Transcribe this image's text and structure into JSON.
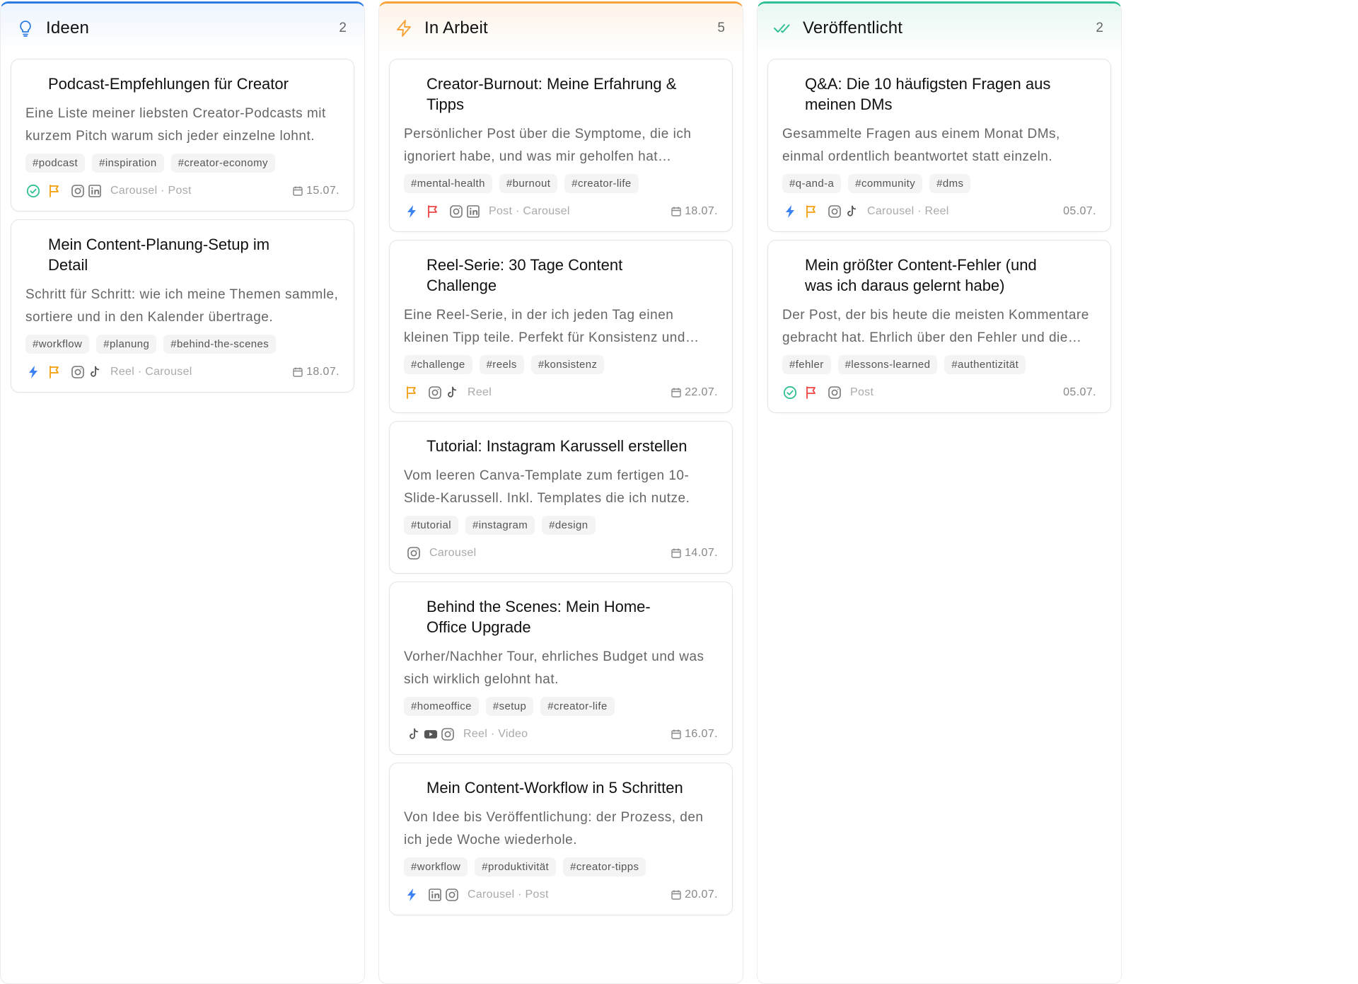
{
  "colors": {
    "ideen_accent": "#2b7de1",
    "arbeit_accent": "#f7a33a",
    "publ_accent": "#2fbf94",
    "check": "#2fbf94",
    "bolt": "#3b82f6",
    "flag_orange": "#f59e0b",
    "flag_red": "#ef4444"
  },
  "columns": [
    {
      "id": "ideen",
      "title": "Ideen",
      "count": "2",
      "icon": "lightbulb-icon",
      "cards": [
        {
          "title": "Podcast-Empfehlungen für Creator",
          "desc": "Eine Liste meiner liebsten Creator-Podcasts mit kurzem Pitch warum sich jeder einzelne lohnt.",
          "tags": [
            "#podcast",
            "#inspiration",
            "#creator-economy"
          ],
          "status": "check",
          "flag": "orange",
          "platforms": [
            "instagram",
            "linkedin"
          ],
          "formats": "Carousel · Post",
          "date": "15.07.",
          "show_cal": true
        },
        {
          "title": "Mein Content-Planung-Setup im Detail",
          "desc": "Schritt für Schritt: wie ich meine Themen sammle, sortiere und in den Kalender übertrage.",
          "tags": [
            "#workflow",
            "#planung",
            "#behind-the-scenes"
          ],
          "status": "bolt",
          "flag": "orange",
          "platforms": [
            "instagram",
            "tiktok"
          ],
          "formats": "Reel · Carousel",
          "date": "18.07.",
          "show_cal": true
        }
      ]
    },
    {
      "id": "arbeit",
      "title": "In Arbeit",
      "count": "5",
      "icon": "bolt-icon",
      "cards": [
        {
          "title": "Creator-Burnout: Meine Erfahrung & Tipps",
          "desc": "Persönlicher Post über die Symptome, die ich ignoriert habe, und was mir geholfen hat zurückzufinden.",
          "tags": [
            "#mental-health",
            "#burnout",
            "#creator-life"
          ],
          "status": "bolt",
          "flag": "red",
          "platforms": [
            "instagram",
            "linkedin"
          ],
          "formats": "Post · Carousel",
          "date": "18.07.",
          "show_cal": true
        },
        {
          "title": "Reel-Serie: 30 Tage Content Challenge",
          "desc": "Eine Reel-Serie, in der ich jeden Tag einen kleinen Tipp teile. Perfekt für Konsistenz und Reichweite.",
          "tags": [
            "#challenge",
            "#reels",
            "#konsistenz"
          ],
          "status": "",
          "flag": "orange",
          "platforms": [
            "instagram",
            "tiktok"
          ],
          "formats": "Reel",
          "date": "22.07.",
          "show_cal": true
        },
        {
          "title": "Tutorial: Instagram Karussell erstellen",
          "desc": "Vom leeren Canva-Template zum fertigen 10-Slide-Karussell. Inkl. Templates die ich nutze.",
          "tags": [
            "#tutorial",
            "#instagram",
            "#design"
          ],
          "status": "",
          "flag": "",
          "platforms": [
            "instagram"
          ],
          "formats": "Carousel",
          "date": "14.07.",
          "show_cal": true
        },
        {
          "title": "Behind the Scenes: Mein Home-Office Upgrade",
          "desc": "Vorher/Nachher Tour, ehrliches Budget und was sich wirklich gelohnt hat.",
          "tags": [
            "#homeoffice",
            "#setup",
            "#creator-life"
          ],
          "status": "",
          "flag": "",
          "platforms": [
            "tiktok",
            "youtube",
            "instagram"
          ],
          "formats": "Reel · Video",
          "date": "16.07.",
          "show_cal": true
        },
        {
          "title": "Mein Content-Workflow in 5 Schritten",
          "desc": "Von Idee bis Veröffentlichung: der Prozess, den ich jede Woche wiederhole.",
          "tags": [
            "#workflow",
            "#produktivität",
            "#creator-tipps"
          ],
          "status": "bolt",
          "flag": "",
          "platforms": [
            "linkedin",
            "instagram"
          ],
          "formats": "Carousel · Post",
          "date": "20.07.",
          "show_cal": true
        }
      ]
    },
    {
      "id": "publ",
      "title": "Veröffentlicht",
      "count": "2",
      "icon": "double-check-icon",
      "cards": [
        {
          "title": "Q&A: Die 10 häufigsten Fragen aus meinen DMs",
          "desc": "Gesammelte Fragen aus einem Monat DMs, einmal ordentlich beantwortet statt einzeln.",
          "tags": [
            "#q-and-a",
            "#community",
            "#dms"
          ],
          "status": "bolt",
          "flag": "orange",
          "platforms": [
            "instagram",
            "tiktok"
          ],
          "formats": "Carousel · Reel",
          "date": "05.07.",
          "show_cal": false
        },
        {
          "title": "Mein größter Content-Fehler (und was ich daraus gelernt habe)",
          "desc": "Der Post, der bis heute die meisten Kommentare gebracht hat. Ehrlich über den Fehler und die Lehren.",
          "tags": [
            "#fehler",
            "#lessons-learned",
            "#authentizität"
          ],
          "status": "check",
          "flag": "red",
          "platforms": [
            "instagram"
          ],
          "formats": "Post",
          "date": "05.07.",
          "show_cal": false
        }
      ]
    }
  ]
}
